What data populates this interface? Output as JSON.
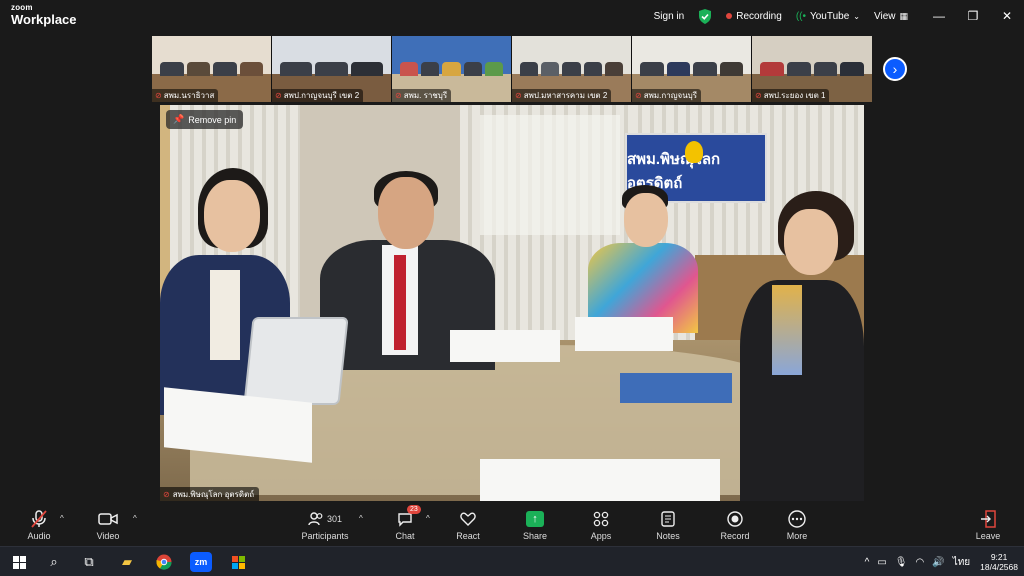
{
  "app": {
    "brand_top": "zoom",
    "brand_bottom": "Workplace"
  },
  "titlebar": {
    "sign_in": "Sign in",
    "recording": "Recording",
    "youtube": "YouTube",
    "view": "View"
  },
  "thumbnails": [
    {
      "label": "สพม.นราธิวาส"
    },
    {
      "label": "สพป.กาญจนบุรี เขต 2"
    },
    {
      "label": "สพม. ราชบุรี"
    },
    {
      "label": "สพป.มหาสารคาม เขต 2"
    },
    {
      "label": "สพม.กาญจนบุรี"
    },
    {
      "label": "สพป.ระยอง เขต 1"
    }
  ],
  "main_video": {
    "pin_label": "Remove pin",
    "participant_name": "สพม.พิษณุโลก อุตรดิตถ์",
    "sign_text": "สพม.พิษณุโลก อุตรดิตถ์"
  },
  "toolbar": {
    "audio": "Audio",
    "video": "Video",
    "participants": "Participants",
    "participants_count": "301",
    "chat": "Chat",
    "chat_badge": "23",
    "react": "React",
    "share": "Share",
    "apps": "Apps",
    "notes": "Notes",
    "record": "Record",
    "more": "More",
    "leave": "Leave"
  },
  "taskbar": {
    "lang": "ไทย",
    "time": "9:21",
    "date": "18/4/2568"
  },
  "colors": {
    "accent_blue": "#0b5cff",
    "recording_red": "#e0463d",
    "share_green": "#1bb158"
  }
}
